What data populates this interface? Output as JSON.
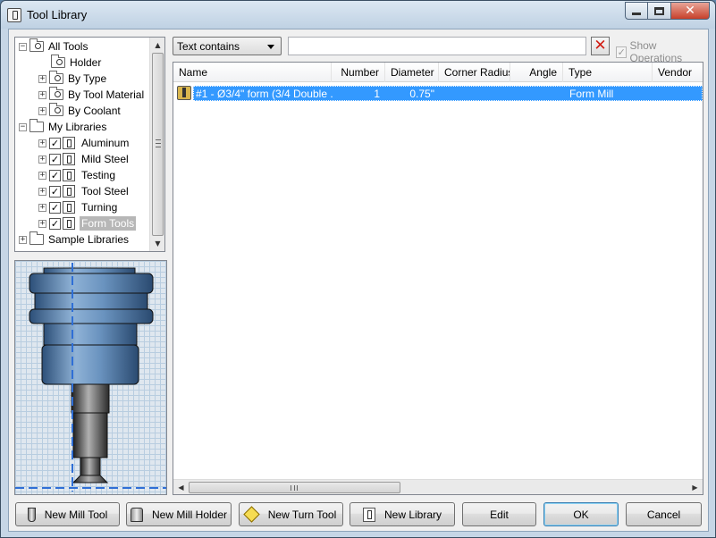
{
  "window": {
    "title": "Tool Library"
  },
  "tree": {
    "items": [
      {
        "label": "All Tools"
      },
      {
        "label": "Holder"
      },
      {
        "label": "By Type"
      },
      {
        "label": "By Tool Material"
      },
      {
        "label": "By Coolant"
      },
      {
        "label": "My Libraries"
      },
      {
        "label": "Aluminum",
        "checked": "✓"
      },
      {
        "label": "Mild Steel",
        "checked": "✓"
      },
      {
        "label": "Testing",
        "checked": "✓"
      },
      {
        "label": "Tool Steel",
        "checked": "✓"
      },
      {
        "label": "Turning",
        "checked": "✓"
      },
      {
        "label": "Form Tools",
        "checked": "✓",
        "selected": true
      },
      {
        "label": "Sample Libraries"
      }
    ]
  },
  "filter": {
    "mode": "Text contains",
    "search_value": "",
    "clear_glyph": "✕",
    "show_operations_label": "Show Operations",
    "show_operations_check": "✓"
  },
  "grid": {
    "columns": [
      "Name",
      "Number",
      "Diameter",
      "Corner Radius",
      "Angle",
      "Type",
      "Vendor"
    ],
    "rows": [
      {
        "name": "#1 - Ø3/4\" form (3/4 Double ...",
        "number": "1",
        "diameter": "0.75\"",
        "corner_radius": "",
        "angle": "",
        "type": "Form Mill",
        "vendor": ""
      }
    ]
  },
  "buttons": {
    "new_mill_tool": "New Mill Tool",
    "new_mill_holder": "New Mill Holder",
    "new_turn_tool": "New Turn Tool",
    "new_library": "New Library",
    "edit": "Edit",
    "ok": "OK",
    "cancel": "Cancel"
  },
  "colors": {
    "selection": "#3399ff",
    "preview_tool": "#4f7fae",
    "accent_clear": "#d21b12"
  }
}
